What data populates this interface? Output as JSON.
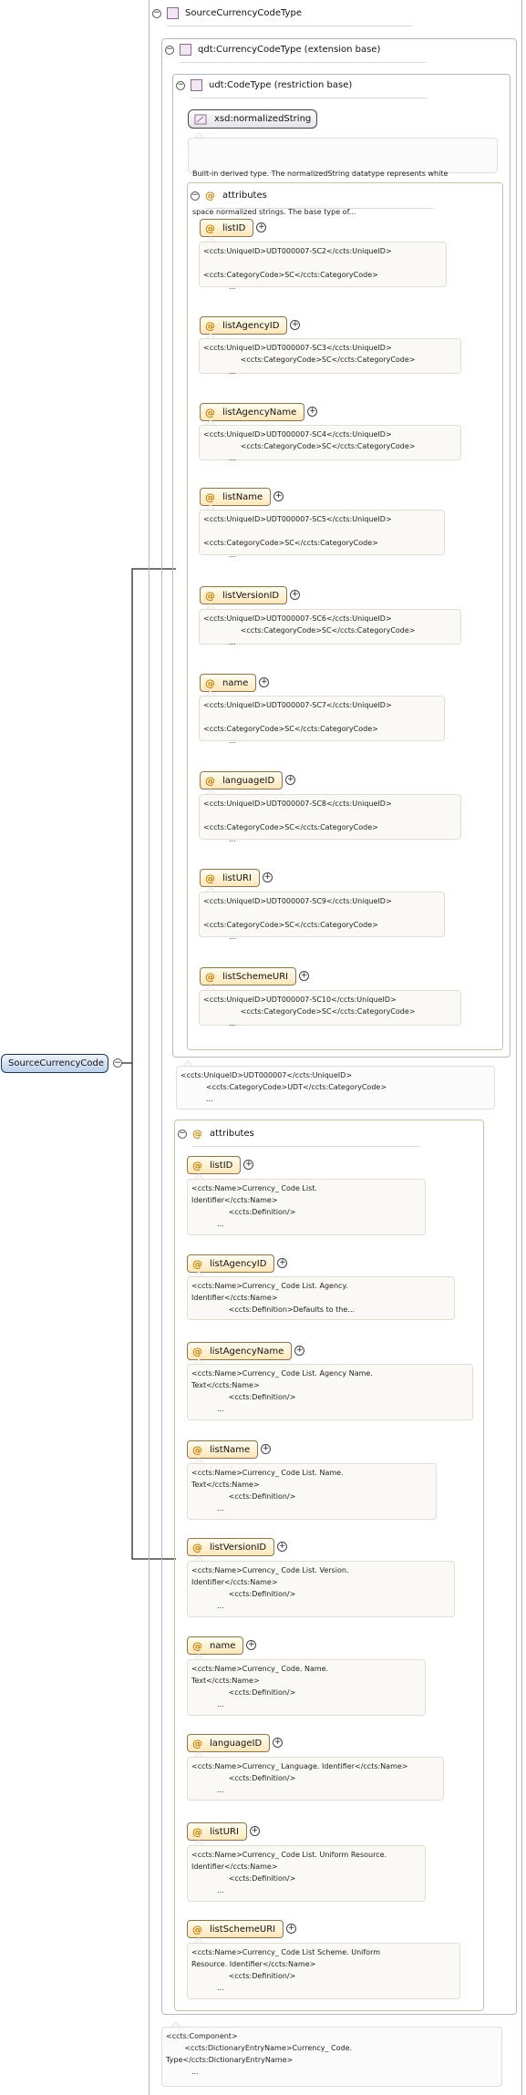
{
  "root": {
    "label": "SourceCurrencyCode",
    "toggle": "−"
  },
  "main": {
    "label": "SourceCurrencyCodeType",
    "toggle": "−"
  },
  "extension": {
    "label": "qdt:CurrencyCodeType (extension base)",
    "toggle": "−"
  },
  "restriction": {
    "label": "udt:CodeType (restriction base)",
    "toggle": "−"
  },
  "normalized": {
    "label": "xsd:normalizedString",
    "doc_line1": "Built-in derived type. The normalizedString datatype represents white",
    "doc_line2": "space normalized strings. The base type of..."
  },
  "inner_attributes": {
    "header": "attributes",
    "items": [
      {
        "name": "listID",
        "plus": "+",
        "doc": "<ccts:UniqueID>UDT000007-SC2</ccts:UniqueID>\n\n<ccts:CategoryCode>SC</ccts:CategoryCode>\n           ..."
      },
      {
        "name": "listAgencyID",
        "plus": "+",
        "doc": "<ccts:UniqueID>UDT000007-SC3</ccts:UniqueID>\n                <ccts:CategoryCode>SC</ccts:CategoryCode>\n           ..."
      },
      {
        "name": "listAgencyName",
        "plus": "+",
        "doc": "<ccts:UniqueID>UDT000007-SC4</ccts:UniqueID>\n                <ccts:CategoryCode>SC</ccts:CategoryCode>\n           ..."
      },
      {
        "name": "listName",
        "plus": "+",
        "doc": "<ccts:UniqueID>UDT000007-SC5</ccts:UniqueID>\n\n<ccts:CategoryCode>SC</ccts:CategoryCode>\n           ..."
      },
      {
        "name": "listVersionID",
        "plus": "+",
        "doc": "<ccts:UniqueID>UDT000007-SC6</ccts:UniqueID>\n                <ccts:CategoryCode>SC</ccts:CategoryCode>\n           ..."
      },
      {
        "name": "name",
        "plus": "+",
        "doc": "<ccts:UniqueID>UDT000007-SC7</ccts:UniqueID>\n\n<ccts:CategoryCode>SC</ccts:CategoryCode>\n           ..."
      },
      {
        "name": "languageID",
        "plus": "+",
        "doc": "<ccts:UniqueID>UDT000007-SC8</ccts:UniqueID>\n\n<ccts:CategoryCode>SC</ccts:CategoryCode>\n           ..."
      },
      {
        "name": "listURI",
        "plus": "+",
        "doc": "<ccts:UniqueID>UDT000007-SC9</ccts:UniqueID>\n\n<ccts:CategoryCode>SC</ccts:CategoryCode>\n           ..."
      },
      {
        "name": "listSchemeURI",
        "plus": "+",
        "doc": "<ccts:UniqueID>UDT000007-SC10</ccts:UniqueID>\n                <ccts:CategoryCode>SC</ccts:CategoryCode>\n           ..."
      }
    ]
  },
  "restriction_doc": "<ccts:UniqueID>UDT000007</ccts:UniqueID>\n           <ccts:CategoryCode>UDT</ccts:CategoryCode>\n           ...",
  "outer_attributes": {
    "header": "attributes",
    "items": [
      {
        "name": "listID",
        "plus": "+",
        "doc": "<ccts:Name>Currency_ Code List.\nIdentifier</ccts:Name>\n                <ccts:Definition/>\n           ..."
      },
      {
        "name": "listAgencyID",
        "plus": "+",
        "doc": "<ccts:Name>Currency_ Code List. Agency.\nIdentifier</ccts:Name>\n                <ccts:Definition>Defaults to the...\n"
      },
      {
        "name": "listAgencyName",
        "plus": "+",
        "doc": "<ccts:Name>Currency_ Code List. Agency Name.\nText</ccts:Name>\n                <ccts:Definition/>\n           ..."
      },
      {
        "name": "listName",
        "plus": "+",
        "doc": "<ccts:Name>Currency_ Code List. Name.\nText</ccts:Name>\n                <ccts:Definition/>\n           ..."
      },
      {
        "name": "listVersionID",
        "plus": "+",
        "doc": "<ccts:Name>Currency_ Code List. Version.\nIdentifier</ccts:Name>\n                <ccts:Definition/>\n           ..."
      },
      {
        "name": "name",
        "plus": "+",
        "doc": "<ccts:Name>Currency_ Code. Name.\nText</ccts:Name>\n                <ccts:Definition/>\n           ..."
      },
      {
        "name": "languageID",
        "plus": "+",
        "doc": "<ccts:Name>Currency_ Language. Identifier</ccts:Name>\n                <ccts:Definition/>\n           ..."
      },
      {
        "name": "listURI",
        "plus": "+",
        "doc": "<ccts:Name>Currency_ Code List. Uniform Resource.\nIdentifier</ccts:Name>\n                <ccts:Definition/>\n           ..."
      },
      {
        "name": "listSchemeURI",
        "plus": "+",
        "doc": "<ccts:Name>Currency_ Code List Scheme. Uniform\nResource. Identifier</ccts:Name>\n                <ccts:Definition/>\n           ..."
      }
    ]
  },
  "component_doc": "<ccts:Component>\n        <ccts:DictionaryEntryName>Currency_ Code.\nType</ccts:DictionaryEntryName>\n           ..."
}
